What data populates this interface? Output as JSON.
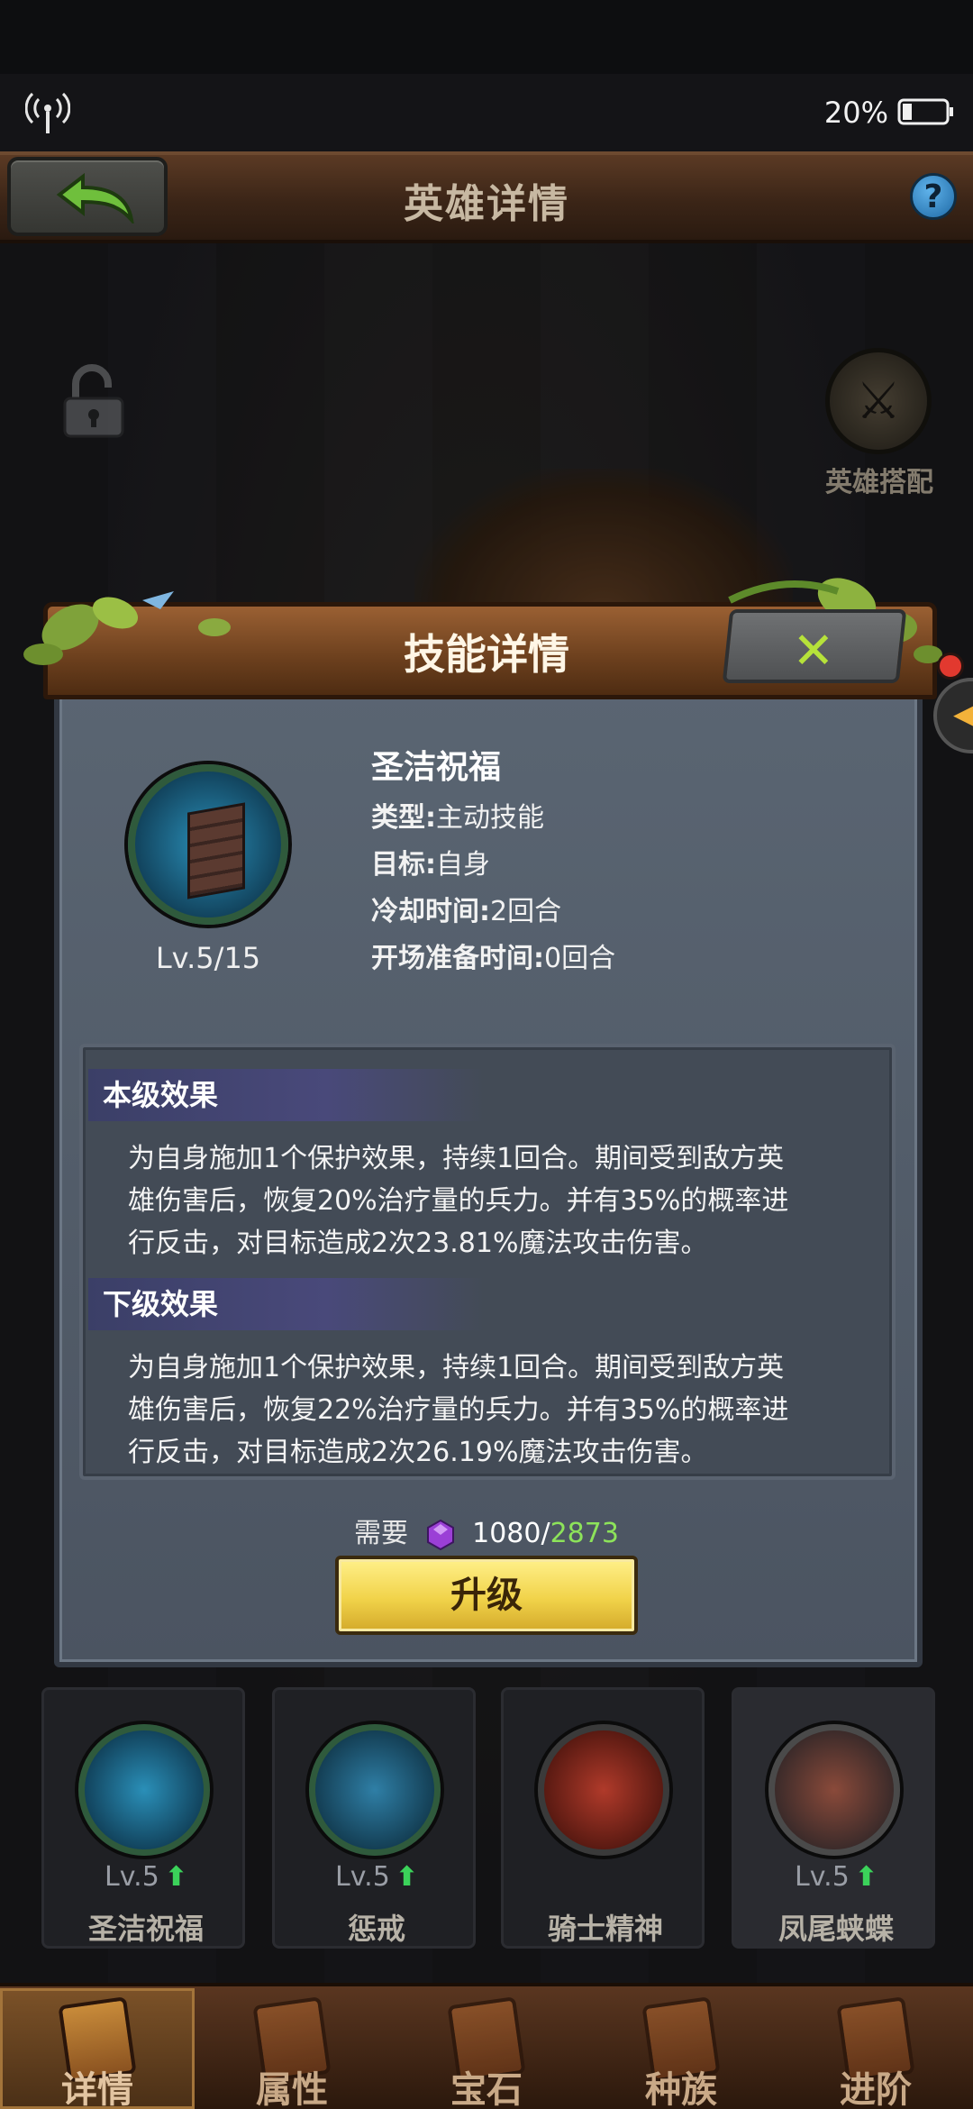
{
  "status_bar": {
    "battery": "20%",
    "icons": [
      "signal-icon",
      "battery-icon"
    ]
  },
  "header": {
    "title": "英雄详情",
    "help": "?"
  },
  "hero_pair": {
    "label": "英雄搭配"
  },
  "dialog": {
    "title": "技能详情",
    "skill": {
      "name": "圣洁祝福",
      "level": "Lv.5/15",
      "type_label": "类型:",
      "type_value": "主动技能",
      "target_label": "目标:",
      "target_value": "自身",
      "cooldown_label": "冷却时间:",
      "cooldown_value": "2回合",
      "prep_label": "开场准备时间:",
      "prep_value": "0回合"
    },
    "current_effect": {
      "title": "本级效果",
      "lines": [
        "为自身施加1个保护效果，持续1回合。期间受到敌方英",
        "雄伤害后，恢复20%治疗量的兵力。并有35%的概率进",
        "行反击，对目标造成2次23.81%魔法攻击伤害。"
      ]
    },
    "next_effect": {
      "title": "下级效果",
      "lines": [
        "为自身施加1个保护效果，持续1回合。期间受到敌方英",
        "雄伤害后，恢复22%治疗量的兵力。并有35%的概率进",
        "行反击，对目标造成2次26.19%魔法攻击伤害。"
      ]
    },
    "cost": {
      "label": "需要",
      "required": "1080",
      "separator": "/",
      "owned": "2873"
    },
    "upgrade_label": "升级"
  },
  "skill_slots": [
    {
      "name": "圣洁祝福",
      "level": "Lv.5",
      "up": "⬆"
    },
    {
      "name": "惩戒",
      "level": "Lv.5",
      "up": "⬆"
    },
    {
      "name": "骑士精神",
      "level": "",
      "up": ""
    },
    {
      "name": "凤尾蛱蝶",
      "level": "Lv.5",
      "up": "⬆"
    }
  ],
  "tabs": [
    "详情",
    "属性",
    "宝石",
    "种族",
    "进阶"
  ],
  "colors": {
    "accent_green": "#8de35a",
    "upgrade_yellow": "#f1d34a",
    "header_brown": "#3b2517"
  }
}
